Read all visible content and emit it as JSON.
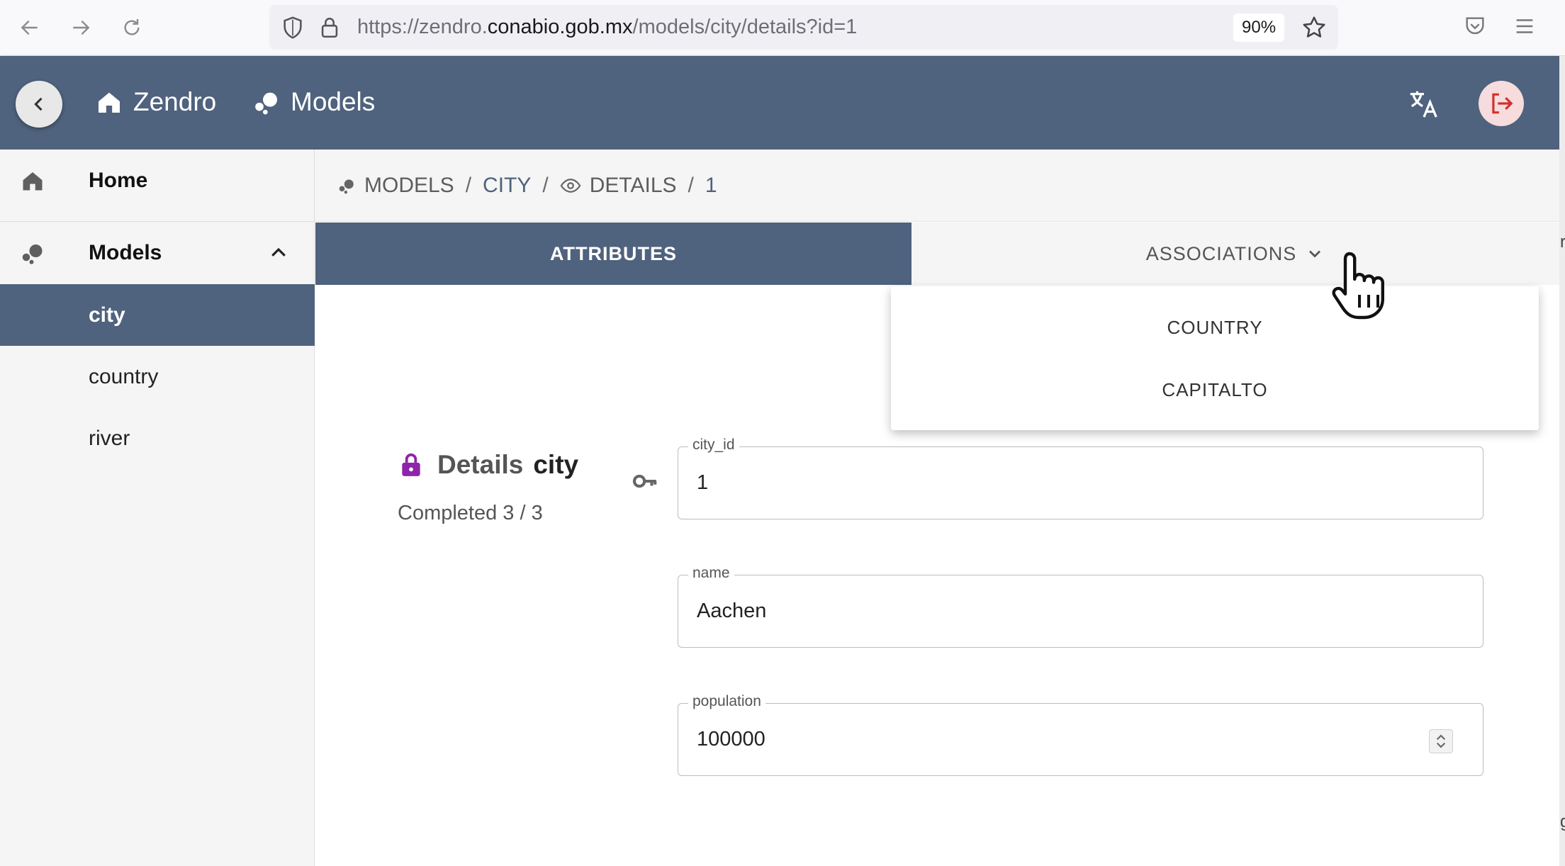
{
  "browser": {
    "url_prefix": "https://zendro.",
    "url_domain": "conabio.gob.mx",
    "url_path": "/models/city/details?id=1",
    "zoom": "90%"
  },
  "header": {
    "home_label": "Zendro",
    "models_label": "Models"
  },
  "sidebar": {
    "home_label": "Home",
    "models_label": "Models",
    "items": [
      {
        "label": "city",
        "selected": true
      },
      {
        "label": "country",
        "selected": false
      },
      {
        "label": "river",
        "selected": false
      }
    ]
  },
  "breadcrumb": {
    "models": "MODELS",
    "sep": "/",
    "city": "CITY",
    "details": "DETAILS",
    "id": "1"
  },
  "tabs": {
    "attributes": "ATTRIBUTES",
    "associations": "ASSOCIATIONS"
  },
  "associations_menu": {
    "items": [
      "COUNTRY",
      "CAPITALTO"
    ]
  },
  "details": {
    "title_prefix": "Details",
    "title_model": "city",
    "completed": "Completed 3 / 3"
  },
  "fields": [
    {
      "label": "city_id",
      "value": "1"
    },
    {
      "label": "name",
      "value": "Aachen"
    },
    {
      "label": "population",
      "value": "100000"
    }
  ],
  "edge_text": {
    "top": "r",
    "bottom": "g"
  },
  "colors": {
    "primary": "#4f627e",
    "lock_accent": "#8e24aa",
    "logout_accent": "#d32f2f"
  }
}
